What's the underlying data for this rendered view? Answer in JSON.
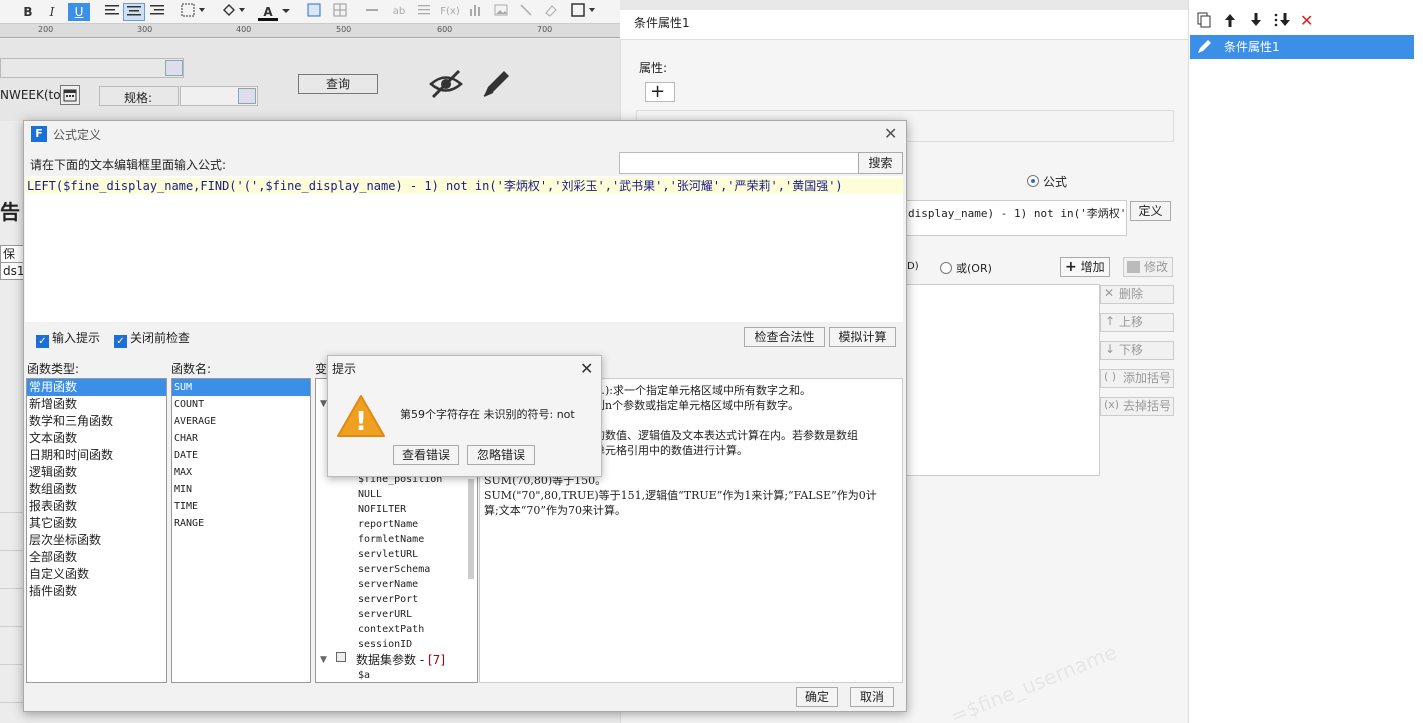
{
  "toolbar": {
    "bold": "B",
    "italic": "I",
    "underline": "U",
    "font_color": "A",
    "ab_icon": "ab",
    "fx_icon": "F(x)"
  },
  "ruler": {
    "ticks": [
      "200",
      "300",
      "400",
      "500",
      "600",
      "700"
    ]
  },
  "params": {
    "week_label": "NWEEK(to",
    "spec_label": "规格:",
    "query_button": "查询"
  },
  "designer": {
    "report_char": "告",
    "tab_label": "保质",
    "cell_label": "ds1"
  },
  "cond_window": {
    "title": "条件属性1",
    "attr_label": "属性:",
    "add_icon": "+",
    "formula_radio": "公式",
    "formula_preview": "display_name) - 1) not in('李炳权')",
    "define_button": "定义",
    "and_label": "D)",
    "or_label": "或(OR)",
    "add_button": "增加",
    "modify_button": "修改",
    "side_buttons": [
      "删除",
      "上移",
      "下移",
      "添加括号",
      "去掉括号"
    ]
  },
  "side_panel": {
    "item": "条件属性1"
  },
  "formula_dialog": {
    "title": "公式定义",
    "prompt": "请在下面的文本编辑框里面输入公式:",
    "search_button": "搜索",
    "formula_text": "LEFT($fine_display_name,FIND('(',$fine_display_name) - 1) not in('李炳权','刘彩玉','武书果','张河耀','严荣莉','黄国强')",
    "input_hint_label": "输入提示",
    "close_check_label": "关闭前检查",
    "check_button": "检查合法性",
    "simulate_button": "模拟计算",
    "func_type_header": "函数类型:",
    "func_name_header": "函数名:",
    "var_header": "变",
    "func_types": [
      "常用函数",
      "新增函数",
      "数学和三角函数",
      "文本函数",
      "日期和时间函数",
      "逻辑函数",
      "数组函数",
      "报表函数",
      "其它函数",
      "层次坐标函数",
      "全部函数",
      "自定义函数",
      "插件函数"
    ],
    "func_names": [
      "SUM",
      "COUNT",
      "AVERAGE",
      "CHAR",
      "DATE",
      "MAX",
      "MIN",
      "TIME",
      "RANGE"
    ],
    "variables": [
      "$fine_position",
      "NULL",
      "NOFILTER",
      "reportName",
      "formletName",
      "servletURL",
      "serverSchema",
      "serverName",
      "serverPort",
      "serverURL",
      "contextPath",
      "sessionID"
    ],
    "dataset_params": "数据集参数",
    "dataset_count": "[7]",
    "last_var": "$a",
    "desc_lines": [
      "…):求一个指定单元格区域中所有数字之和。",
      "到n个参数或指定单元格区域中所有数字。",
      "",
      "的数值、逻辑值及文本表达式计算在内。若参数是数组",
      "单元格引用中的数值进行计算。",
      "",
      "",
      "SUM(70,80)等于150。",
      "SUM(\"70\",80,TRUE)等于151,逻辑值“TRUE”作为1来计算;“FALSE”作为0计",
      "算;文本“70”作为70来计算。"
    ],
    "ok_button": "确定",
    "cancel_button": "取消"
  },
  "alert": {
    "title": "提示",
    "message": "第59个字符存在 未识别的符号: not",
    "view_error_button": "查看错误",
    "ignore_button": "忽略错误",
    "warning_icon": "!"
  },
  "watermark": "=$fine_username"
}
